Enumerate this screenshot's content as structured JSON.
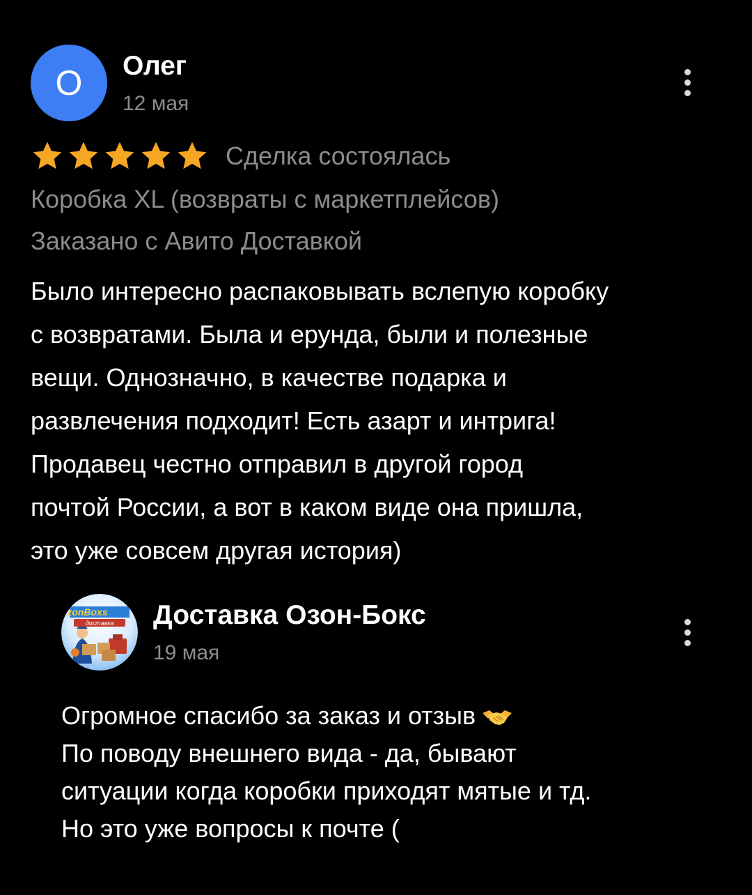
{
  "review": {
    "avatar_letter": "О",
    "author": "Олег",
    "date": "12 мая",
    "rating": 5,
    "rating_max": 5,
    "deal_status": "Сделка состоялась",
    "product": "Коробка XL (возвраты с маркетплейсов)",
    "delivery": "Заказано с Авито Доставкой",
    "text_lines": [
      "Было интересно распаковывать вслепую коробку",
      "с возвратами. Была и ерунда, были и полезные",
      "вещи. Однозначно, в качестве подарка и",
      "развлечения подходит! Есть азарт и интрига!",
      "Продавец честно отправил в другой город",
      "почтой России, а вот в каком виде она пришла,",
      "это уже совсем другая история)"
    ],
    "menu_icon": "more-vertical-icon"
  },
  "reply": {
    "avatar_logo_text": "OzonBoxs",
    "avatar_logo_subtext": "доставка",
    "author": "Доставка Озон-Бокс",
    "date": "19 мая",
    "text_lines": [
      "Огромное спасибо за заказ и отзыв",
      "По поводу внешнего вида - да, бывают",
      "ситуации когда коробки приходят мятые и тд.",
      "Но это уже вопросы к почте ("
    ],
    "emoji_icon": "handshake-icon",
    "menu_icon": "more-vertical-icon"
  },
  "colors": {
    "background": "#000000",
    "avatar_blue": "#3d7ef5",
    "star": "#f5a623",
    "muted_text": "#8c8c8c",
    "primary_text": "#ffffff"
  }
}
